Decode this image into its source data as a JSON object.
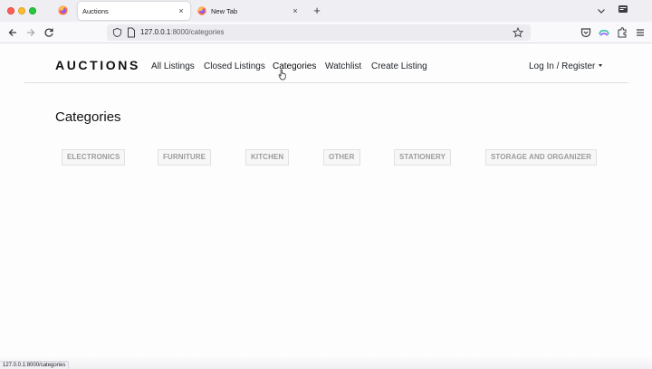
{
  "browser": {
    "tabs": [
      {
        "title": "Auctions",
        "active": true
      },
      {
        "title": "New Tab",
        "active": false
      }
    ],
    "new_tab_symbol": "+",
    "close_symbol": "×",
    "url": {
      "host": "127.0.0.1",
      "path": ":8000/categories"
    },
    "status_url": "127.0.0.1:8000/categories",
    "colors": {
      "close": "#ff5f57",
      "minimize": "#febc2e",
      "zoom": "#28c840",
      "tabstrip": "#efeef2"
    }
  },
  "site": {
    "brand": "AUCTIONS",
    "nav": [
      {
        "label": "All Listings"
      },
      {
        "label": "Closed Listings"
      },
      {
        "label": "Categories"
      },
      {
        "label": "Watchlist"
      },
      {
        "label": "Create Listing"
      }
    ],
    "login_label": "Log In / Register",
    "heading": "Categories",
    "categories": [
      "ELECTRONICS",
      "FURNITURE",
      "KITCHEN",
      "OTHER",
      "STATIONERY",
      "STORAGE AND ORGANIZER"
    ]
  },
  "icons": {
    "back": "arrow-left-icon",
    "forward": "arrow-right-icon",
    "reload": "reload-icon",
    "tracking": "shield-icon",
    "page": "page-icon",
    "bookmark": "star-icon",
    "pocket": "pocket-icon",
    "sync": "sync-icon",
    "extensions": "puzzle-icon",
    "menu": "hamburger-menu-icon"
  }
}
